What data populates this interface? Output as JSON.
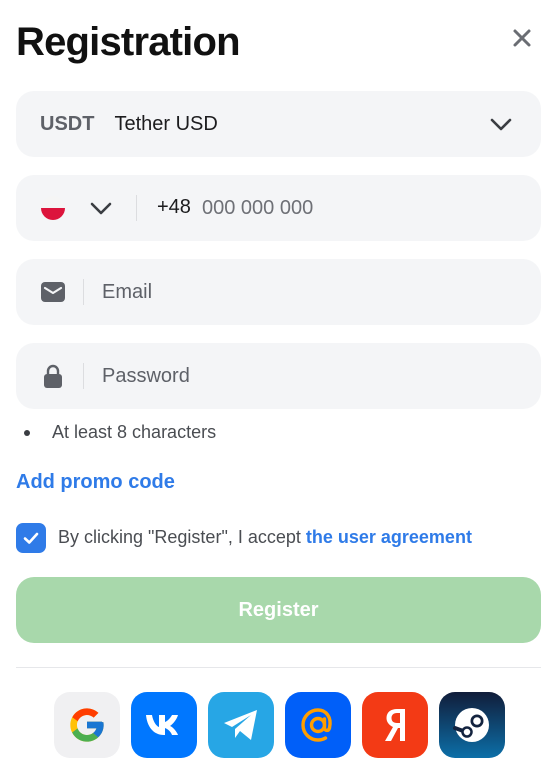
{
  "header": {
    "title": "Registration",
    "close_icon": "close-icon"
  },
  "currency": {
    "code": "USDT",
    "name": "Tether USD",
    "dropdown_icon": "chevron-down-icon"
  },
  "phone": {
    "country_flag": "flag-poland-icon",
    "prefix": "+48",
    "placeholder": "000 000 000",
    "value": ""
  },
  "email": {
    "icon": "envelope-icon",
    "placeholder": "Email",
    "value": ""
  },
  "password": {
    "icon": "lock-icon",
    "placeholder": "Password",
    "value": "",
    "hint": "At least 8 characters"
  },
  "promo": {
    "label": "Add promo code"
  },
  "agreement": {
    "checked": true,
    "text": "By clicking \"Register\", I accept ",
    "link_text": "the user agreement"
  },
  "register": {
    "label": "Register",
    "enabled": false
  },
  "social_login": [
    {
      "name": "google",
      "icon": "google-icon",
      "color": "#f0f0f2"
    },
    {
      "name": "vk",
      "icon": "vk-icon",
      "color": "#0077ff"
    },
    {
      "name": "telegram",
      "icon": "telegram-icon",
      "color": "#27a6e5"
    },
    {
      "name": "mail-ru",
      "icon": "mail-ru-icon",
      "color": "#005ff9"
    },
    {
      "name": "yandex",
      "icon": "yandex-icon",
      "color": "#f33a15"
    },
    {
      "name": "steam",
      "icon": "steam-icon",
      "color": "#0e1a3d"
    }
  ],
  "colors": {
    "accent": "#2f7be8",
    "register_disabled": "#a8d8ab",
    "field_background": "#f4f5f7"
  }
}
